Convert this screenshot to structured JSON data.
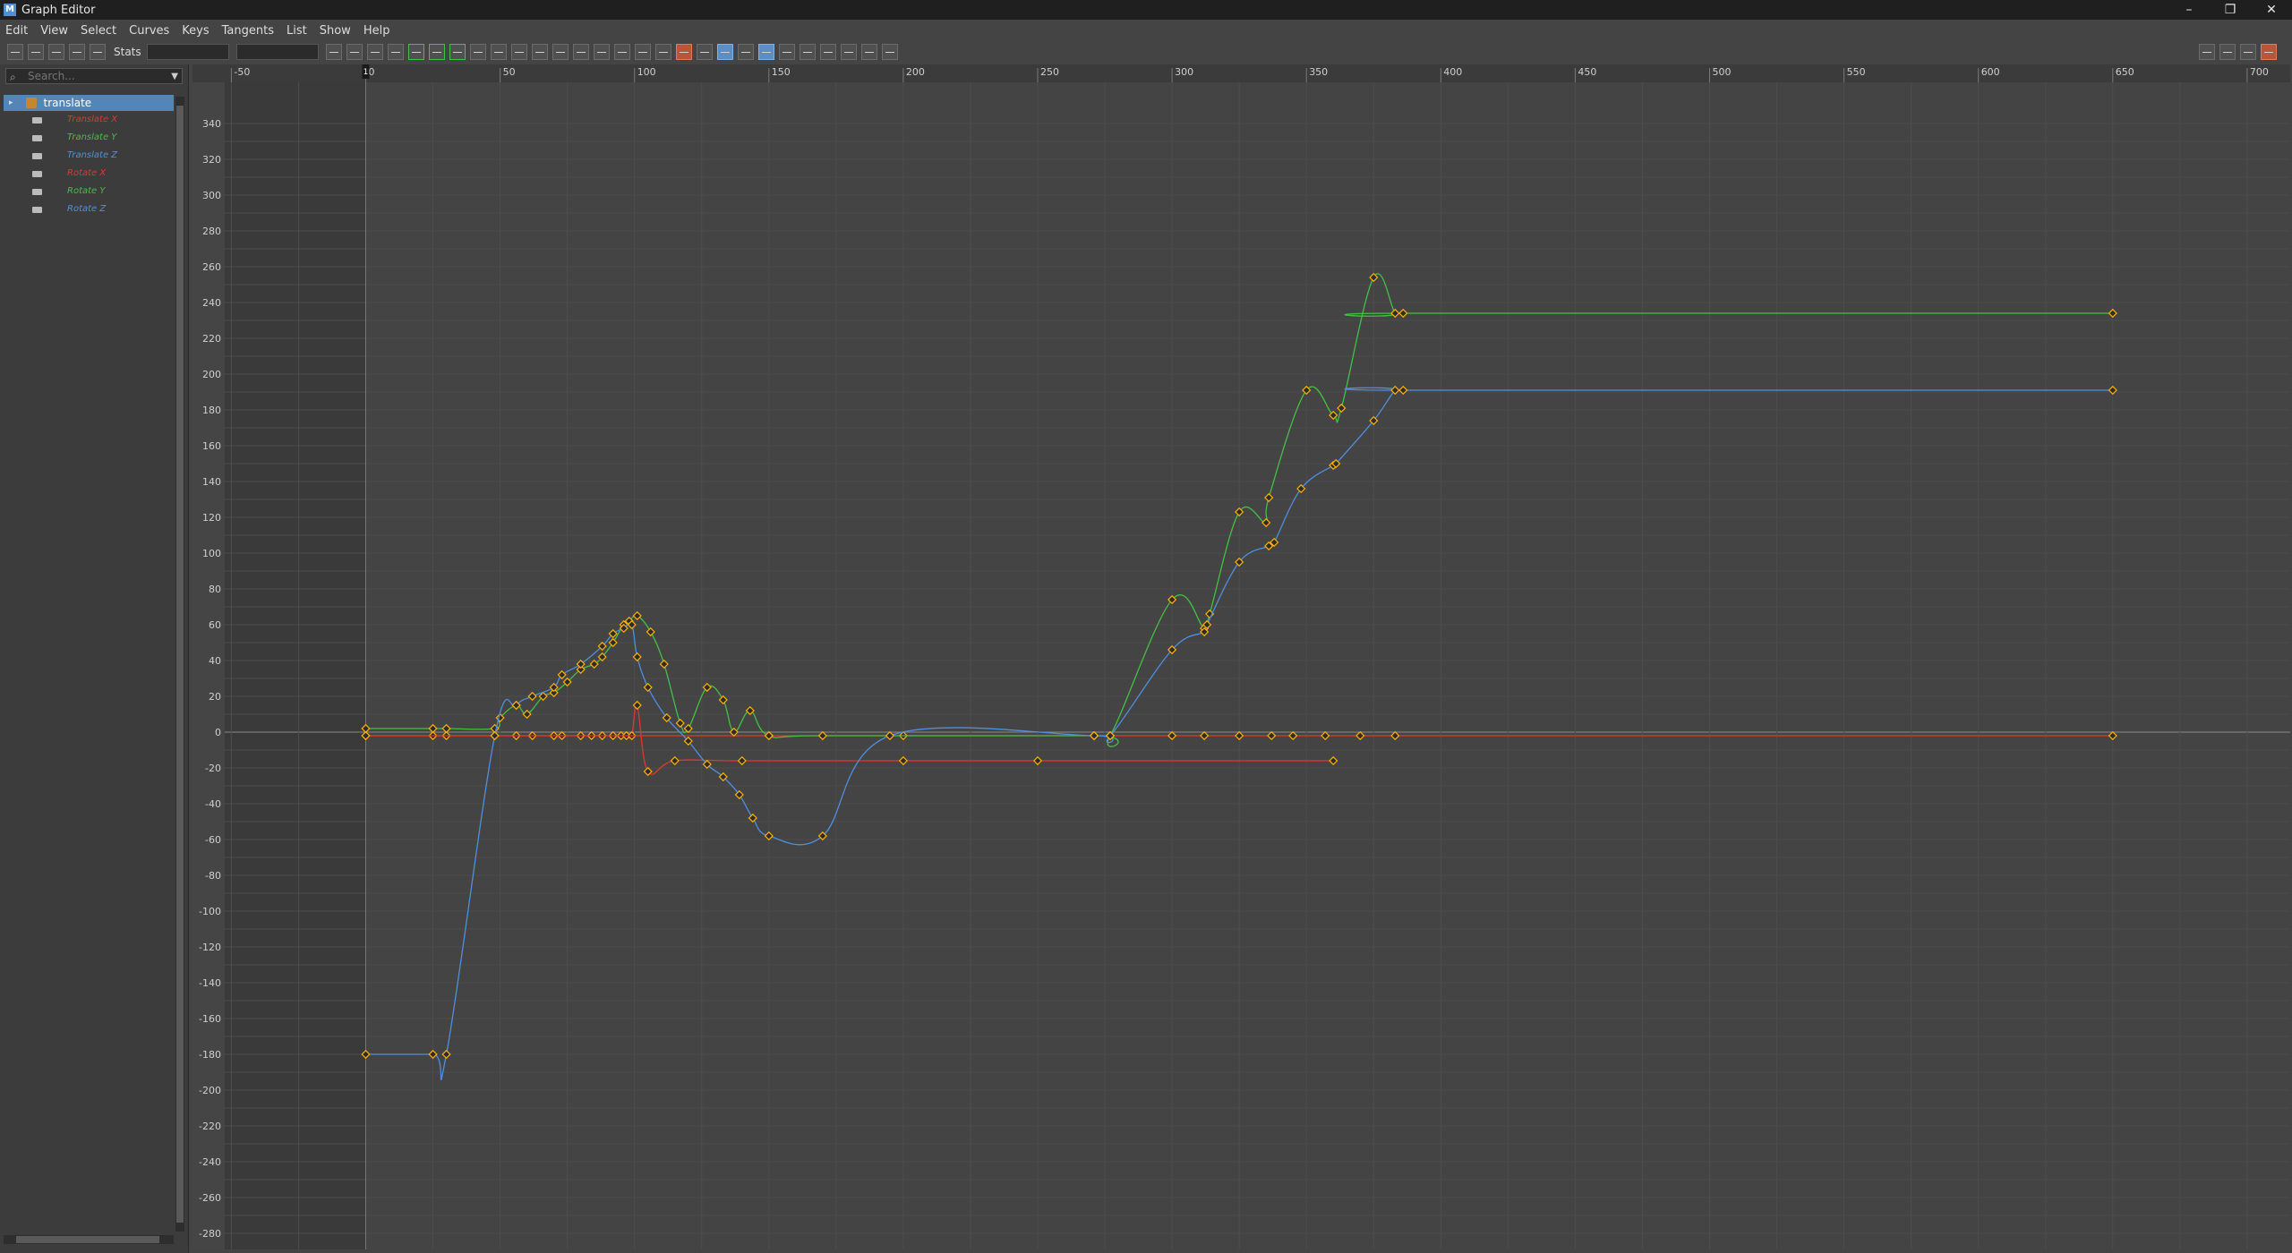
{
  "window": {
    "title": "Graph Editor",
    "app_icon": "M",
    "controls": [
      "–",
      "❐",
      "✕"
    ]
  },
  "menu": [
    "Edit",
    "View",
    "Select",
    "Curves",
    "Keys",
    "Tangents",
    "List",
    "Show",
    "Help"
  ],
  "toolbar": {
    "stats_label": "Stats"
  },
  "outliner": {
    "search_placeholder": "Search...",
    "node": "translate",
    "attributes": [
      {
        "label": "Translate X",
        "color": "#e0372e"
      },
      {
        "label": "Translate Y",
        "color": "#43c043"
      },
      {
        "label": "Translate Z",
        "color": "#4f8fe0"
      },
      {
        "label": "Rotate X",
        "color": "#e0372e"
      },
      {
        "label": "Rotate Y",
        "color": "#43c043"
      },
      {
        "label": "Rotate Z",
        "color": "#4f8fe0"
      }
    ]
  },
  "graph": {
    "playhead_frame": "1",
    "timeline_start": 0,
    "time_ticks": [
      "-50",
      "0",
      "50",
      "100",
      "150",
      "200",
      "250",
      "300",
      "350",
      "400",
      "450",
      "500",
      "550",
      "600",
      "650",
      "700"
    ],
    "value_ticks": [
      "340",
      "320",
      "300",
      "280",
      "260",
      "240",
      "220",
      "200",
      "180",
      "160",
      "140",
      "120",
      "100",
      "80",
      "60",
      "40",
      "20",
      "0",
      "-20",
      "-40",
      "-60",
      "-80",
      "-100",
      "-120",
      "-140",
      "-160",
      "-180",
      "-200",
      "-220",
      "-240",
      "-260",
      "-280"
    ]
  },
  "chart_data": {
    "type": "line",
    "x_range": [
      -50,
      700
    ],
    "y_range": [
      -290,
      350
    ],
    "series": [
      {
        "color": "#e0372e",
        "points": [
          [
            0,
            -2
          ],
          [
            25,
            -2
          ],
          [
            30,
            -2
          ],
          [
            48,
            -2
          ],
          [
            56,
            -2
          ],
          [
            62,
            -2
          ],
          [
            70,
            -2
          ],
          [
            73,
            -2
          ],
          [
            80,
            -2
          ],
          [
            84,
            -2
          ],
          [
            88,
            -2
          ],
          [
            92,
            -2
          ],
          [
            95,
            -2
          ],
          [
            97,
            -2
          ],
          [
            99,
            -2
          ],
          [
            101,
            15
          ],
          [
            105,
            -22
          ],
          [
            115,
            -16
          ],
          [
            140,
            -16
          ],
          [
            200,
            -16
          ],
          [
            250,
            -16
          ],
          [
            360,
            -16
          ]
        ]
      },
      {
        "color": "#e0372e",
        "points": [
          [
            0,
            -2
          ],
          [
            150,
            -2
          ],
          [
            200,
            -2
          ],
          [
            271,
            -2
          ],
          [
            277,
            -2
          ],
          [
            300,
            -2
          ],
          [
            312,
            -2
          ],
          [
            325,
            -2
          ],
          [
            337,
            -2
          ],
          [
            345,
            -2
          ],
          [
            357,
            -2
          ],
          [
            370,
            -2
          ],
          [
            383,
            -2
          ],
          [
            650,
            -2
          ]
        ]
      },
      {
        "color": "#43c043",
        "points": [
          [
            0,
            2
          ],
          [
            25,
            2
          ],
          [
            30,
            2
          ],
          [
            48,
            2
          ],
          [
            50,
            8
          ],
          [
            56,
            15
          ],
          [
            60,
            10
          ],
          [
            66,
            20
          ],
          [
            70,
            22
          ],
          [
            75,
            28
          ],
          [
            80,
            35
          ],
          [
            85,
            38
          ],
          [
            88,
            42
          ],
          [
            92,
            50
          ],
          [
            96,
            60
          ],
          [
            98,
            62
          ],
          [
            101,
            65
          ],
          [
            106,
            56
          ],
          [
            111,
            38
          ],
          [
            117,
            5
          ],
          [
            120,
            2
          ],
          [
            127,
            25
          ],
          [
            133,
            18
          ],
          [
            137,
            0
          ],
          [
            143,
            12
          ],
          [
            150,
            -2
          ],
          [
            170,
            -2
          ],
          [
            271,
            -2
          ],
          [
            277,
            -2
          ],
          [
            300,
            74
          ],
          [
            312,
            58
          ],
          [
            314,
            66
          ],
          [
            325,
            123
          ],
          [
            335,
            117
          ],
          [
            336,
            131
          ],
          [
            350,
            191
          ],
          [
            360,
            177
          ],
          [
            363,
            181
          ],
          [
            375,
            254
          ],
          [
            383,
            234
          ],
          [
            386,
            234
          ],
          [
            650,
            234
          ]
        ]
      },
      {
        "color": "#4f8fe0",
        "points": [
          [
            0,
            -180
          ],
          [
            25,
            -180
          ],
          [
            30,
            -180
          ],
          [
            48,
            -2
          ],
          [
            56,
            15
          ],
          [
            62,
            20
          ],
          [
            70,
            25
          ],
          [
            73,
            32
          ],
          [
            80,
            38
          ],
          [
            88,
            48
          ],
          [
            92,
            55
          ],
          [
            96,
            58
          ],
          [
            99,
            60
          ],
          [
            101,
            42
          ],
          [
            105,
            25
          ],
          [
            112,
            8
          ],
          [
            120,
            -5
          ],
          [
            127,
            -18
          ],
          [
            133,
            -25
          ],
          [
            139,
            -35
          ],
          [
            144,
            -48
          ],
          [
            150,
            -58
          ],
          [
            170,
            -58
          ],
          [
            195,
            -2
          ],
          [
            271,
            -2
          ],
          [
            277,
            -2
          ],
          [
            300,
            46
          ],
          [
            312,
            56
          ],
          [
            313,
            60
          ],
          [
            325,
            95
          ],
          [
            336,
            104
          ],
          [
            338,
            106
          ],
          [
            348,
            136
          ],
          [
            360,
            149
          ],
          [
            361,
            150
          ],
          [
            375,
            174
          ],
          [
            383,
            191
          ],
          [
            386,
            191
          ],
          [
            650,
            191
          ]
        ]
      }
    ]
  }
}
